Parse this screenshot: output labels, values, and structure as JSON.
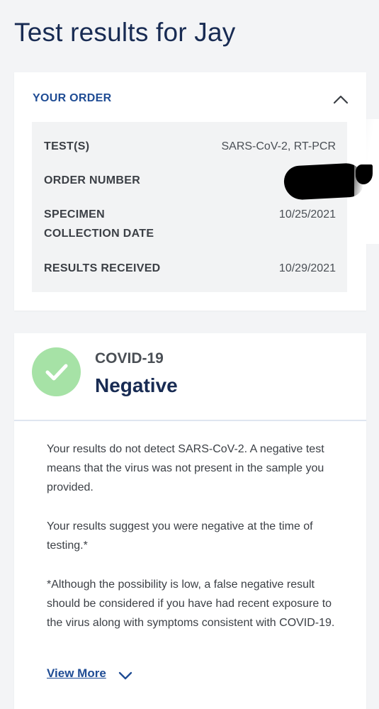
{
  "page": {
    "title": "Test results for Jay"
  },
  "order": {
    "header": "YOUR ORDER",
    "rows": [
      {
        "label": "TEST(S)",
        "value": "SARS-CoV-2, RT-PCR"
      },
      {
        "label": "ORDER NUMBER",
        "value": ""
      },
      {
        "label_line1": "SPECIMEN",
        "label_line2": "COLLECTION DATE",
        "value": "10/25/2021"
      },
      {
        "label": "RESULTS RECEIVED",
        "value": "10/29/2021"
      }
    ]
  },
  "result": {
    "test_name": "COVID-19",
    "status": "Negative",
    "status_color": "#a6e2a6",
    "paragraphs": [
      "Your results do not detect SARS-CoV-2. A negative test means that the virus was not present in the sample you provided.",
      "Your results suggest you were negative at the time of testing.*",
      "*Although the possibility is low, a false negative result should be considered if you have had recent exposure to the virus along with symptoms consistent with COVID-19."
    ],
    "view_more_label": "View More"
  },
  "colors": {
    "accent": "#1f4c94",
    "title": "#182b53",
    "background": "#f3f4f6"
  },
  "icons": {
    "collapse": "chevron-up-icon",
    "status": "checkmark-icon",
    "expand": "chevron-down-icon"
  }
}
